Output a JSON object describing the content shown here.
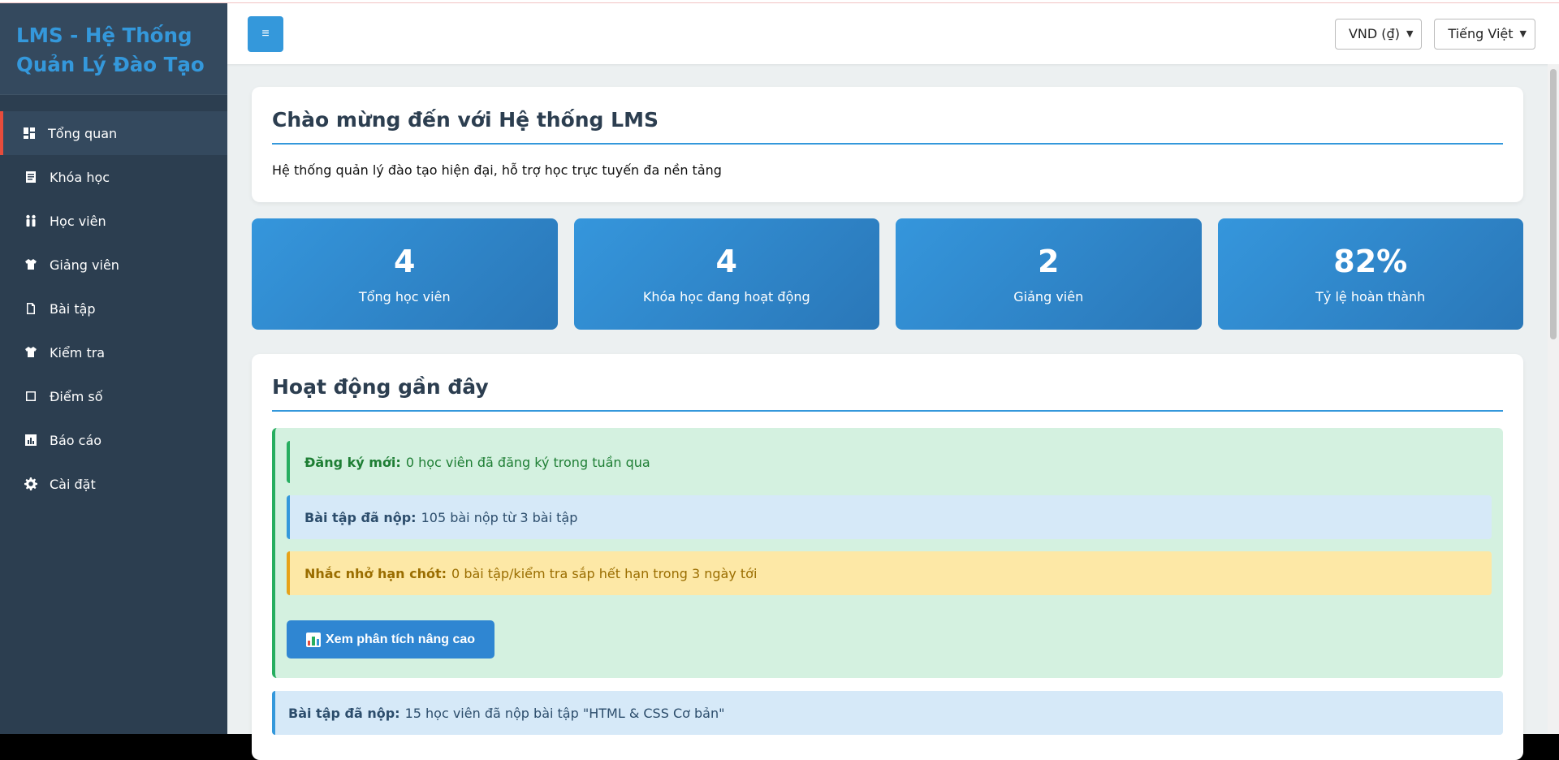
{
  "sidebar": {
    "brand": "LMS - Hệ Thống Quản Lý Đào Tạo",
    "items": [
      {
        "label": "Tổng quan",
        "icon": "dashboard-icon",
        "active": true
      },
      {
        "label": "Khóa học",
        "icon": "book-icon"
      },
      {
        "label": "Học viên",
        "icon": "users-icon"
      },
      {
        "label": "Giảng viên",
        "icon": "teacher-icon"
      },
      {
        "label": "Bài tập",
        "icon": "document-icon"
      },
      {
        "label": "Kiểm tra",
        "icon": "test-icon"
      },
      {
        "label": "Điểm số",
        "icon": "score-icon"
      },
      {
        "label": "Báo cáo",
        "icon": "report-icon"
      },
      {
        "label": "Cài đặt",
        "icon": "gear-icon"
      }
    ]
  },
  "topbar": {
    "menu_label": "≡",
    "currency": "VND (₫)",
    "language": "Tiếng Việt"
  },
  "welcome": {
    "title": "Chào mừng đến với Hệ thống LMS",
    "text": "Hệ thống quản lý đào tạo hiện đại, hỗ trợ học trực tuyến đa nền tảng"
  },
  "stats": [
    {
      "value": "4",
      "label": "Tổng học viên"
    },
    {
      "value": "4",
      "label": "Khóa học đang hoạt động"
    },
    {
      "value": "2",
      "label": "Giảng viên"
    },
    {
      "value": "82%",
      "label": "Tỷ lệ hoàn thành"
    }
  ],
  "activity": {
    "title": "Hoạt động gần đây",
    "notices": [
      {
        "label": "Đăng ký mới:",
        "text": "0 học viên đã đăng ký trong tuần qua"
      },
      {
        "label": "Bài tập đã nộp:",
        "text": "105 bài nộp từ 3 bài tập"
      },
      {
        "label": "Nhắc nhở hạn chót:",
        "text": "0 bài tập/kiểm tra sắp hết hạn trong 3 ngày tới"
      }
    ],
    "button_label": "Xem phân tích nâng cao",
    "next": {
      "label": "Bài tập đã nộp:",
      "text": "15 học viên đã nộp bài tập \"HTML & CSS Cơ bản\""
    }
  },
  "colors": {
    "sidebar_bg": "#2c3e50",
    "accent": "#3498db",
    "active_marker": "#e74c3c"
  }
}
